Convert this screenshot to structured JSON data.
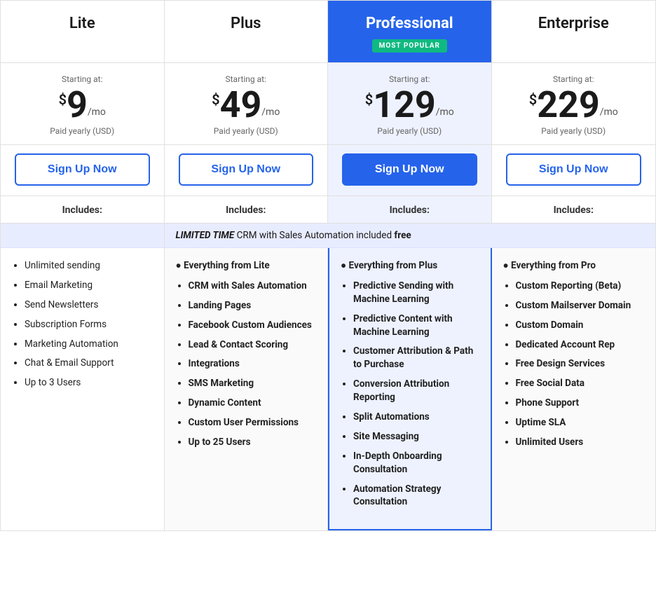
{
  "columns": [
    {
      "id": "lite",
      "title": "Lite",
      "starting_at": "Starting at:",
      "currency": "$",
      "amount": "9",
      "period": "/mo",
      "paid_yearly": "Paid yearly (USD)",
      "cta_label": "Sign Up Now",
      "includes_label": "Includes:",
      "features": [
        "Unlimited sending",
        "Email Marketing",
        "Send Newsletters",
        "Subscription Forms",
        "Marketing Automation",
        "Chat & Email Support",
        "Up to 3 Users"
      ]
    },
    {
      "id": "plus",
      "title": "Plus",
      "starting_at": "Starting at:",
      "currency": "$",
      "amount": "49",
      "period": "/mo",
      "paid_yearly": "Paid yearly (USD)",
      "cta_label": "Sign Up Now",
      "includes_label": "Includes:",
      "features_bold_first": "Everything from Lite",
      "features": [
        "CRM with Sales Automation",
        "Landing Pages",
        "Facebook Custom Audiences",
        "Lead & Contact Scoring",
        "Integrations",
        "SMS Marketing",
        "Dynamic Content",
        "Custom User Permissions",
        "Up to 25 Users"
      ]
    },
    {
      "id": "professional",
      "title": "Professional",
      "badge": "MOST POPULAR",
      "starting_at": "Starting at:",
      "currency": "$",
      "amount": "129",
      "period": "/mo",
      "paid_yearly": "Paid yearly (USD)",
      "cta_label": "Sign Up Now",
      "includes_label": "Includes:",
      "features_bold_first": "Everything from Plus",
      "features": [
        "Predictive Sending with Machine Learning",
        "Predictive Content with Machine Learning",
        "Customer Attribution & Path to Purchase",
        "Conversion Attribution Reporting",
        "Split Automations",
        "Site Messaging",
        "In-Depth Onboarding Consultation",
        "Automation Strategy Consultation"
      ]
    },
    {
      "id": "enterprise",
      "title": "Enterprise",
      "starting_at": "Starting at:",
      "currency": "$",
      "amount": "229",
      "period": "/mo",
      "paid_yearly": "Paid yearly (USD)",
      "cta_label": "Sign Up Now",
      "includes_label": "Includes:",
      "features_bold_first": "Everything from Pro",
      "features": [
        "Custom Reporting (Beta)",
        "Custom Mailserver Domain",
        "Custom Domain",
        "Dedicated Account Rep",
        "Free Design Services",
        "Free Social Data",
        "Phone Support",
        "Uptime SLA",
        "Unlimited Users"
      ]
    }
  ],
  "banner": {
    "label": "LIMITED TIME",
    "text": "CRM with Sales Automation included",
    "bold_text": "free"
  }
}
